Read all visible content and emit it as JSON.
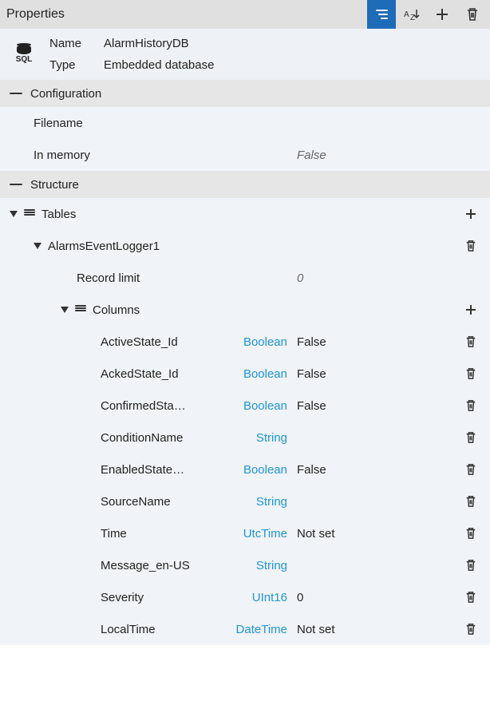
{
  "panel": {
    "title": "Properties"
  },
  "object": {
    "name_label": "Name",
    "name_value": "AlarmHistoryDB",
    "type_label": "Type",
    "type_value": "Embedded database",
    "icon_text": "SQL"
  },
  "sections": {
    "configuration": "Configuration",
    "structure": "Structure"
  },
  "config": {
    "filename_label": "Filename",
    "filename_value": "",
    "inmemory_label": "In memory",
    "inmemory_value": "False"
  },
  "tables": {
    "label": "Tables",
    "items": [
      {
        "name": "AlarmsEventLogger1",
        "record_limit_label": "Record limit",
        "record_limit_value": "0",
        "columns_label": "Columns",
        "columns": [
          {
            "name": "ActiveState_Id",
            "type": "Boolean",
            "value": "False"
          },
          {
            "name": "AckedState_Id",
            "type": "Boolean",
            "value": "False"
          },
          {
            "name": "ConfirmedSta…",
            "type": "Boolean",
            "value": "False"
          },
          {
            "name": "ConditionName",
            "type": "String",
            "value": ""
          },
          {
            "name": "EnabledState…",
            "type": "Boolean",
            "value": "False"
          },
          {
            "name": "SourceName",
            "type": "String",
            "value": ""
          },
          {
            "name": "Time",
            "type": "UtcTime",
            "value": "Not set"
          },
          {
            "name": "Message_en-US",
            "type": "String",
            "value": ""
          },
          {
            "name": "Severity",
            "type": "UInt16",
            "value": "0"
          },
          {
            "name": "LocalTime",
            "type": "DateTime",
            "value": "Not set"
          }
        ]
      }
    ]
  }
}
